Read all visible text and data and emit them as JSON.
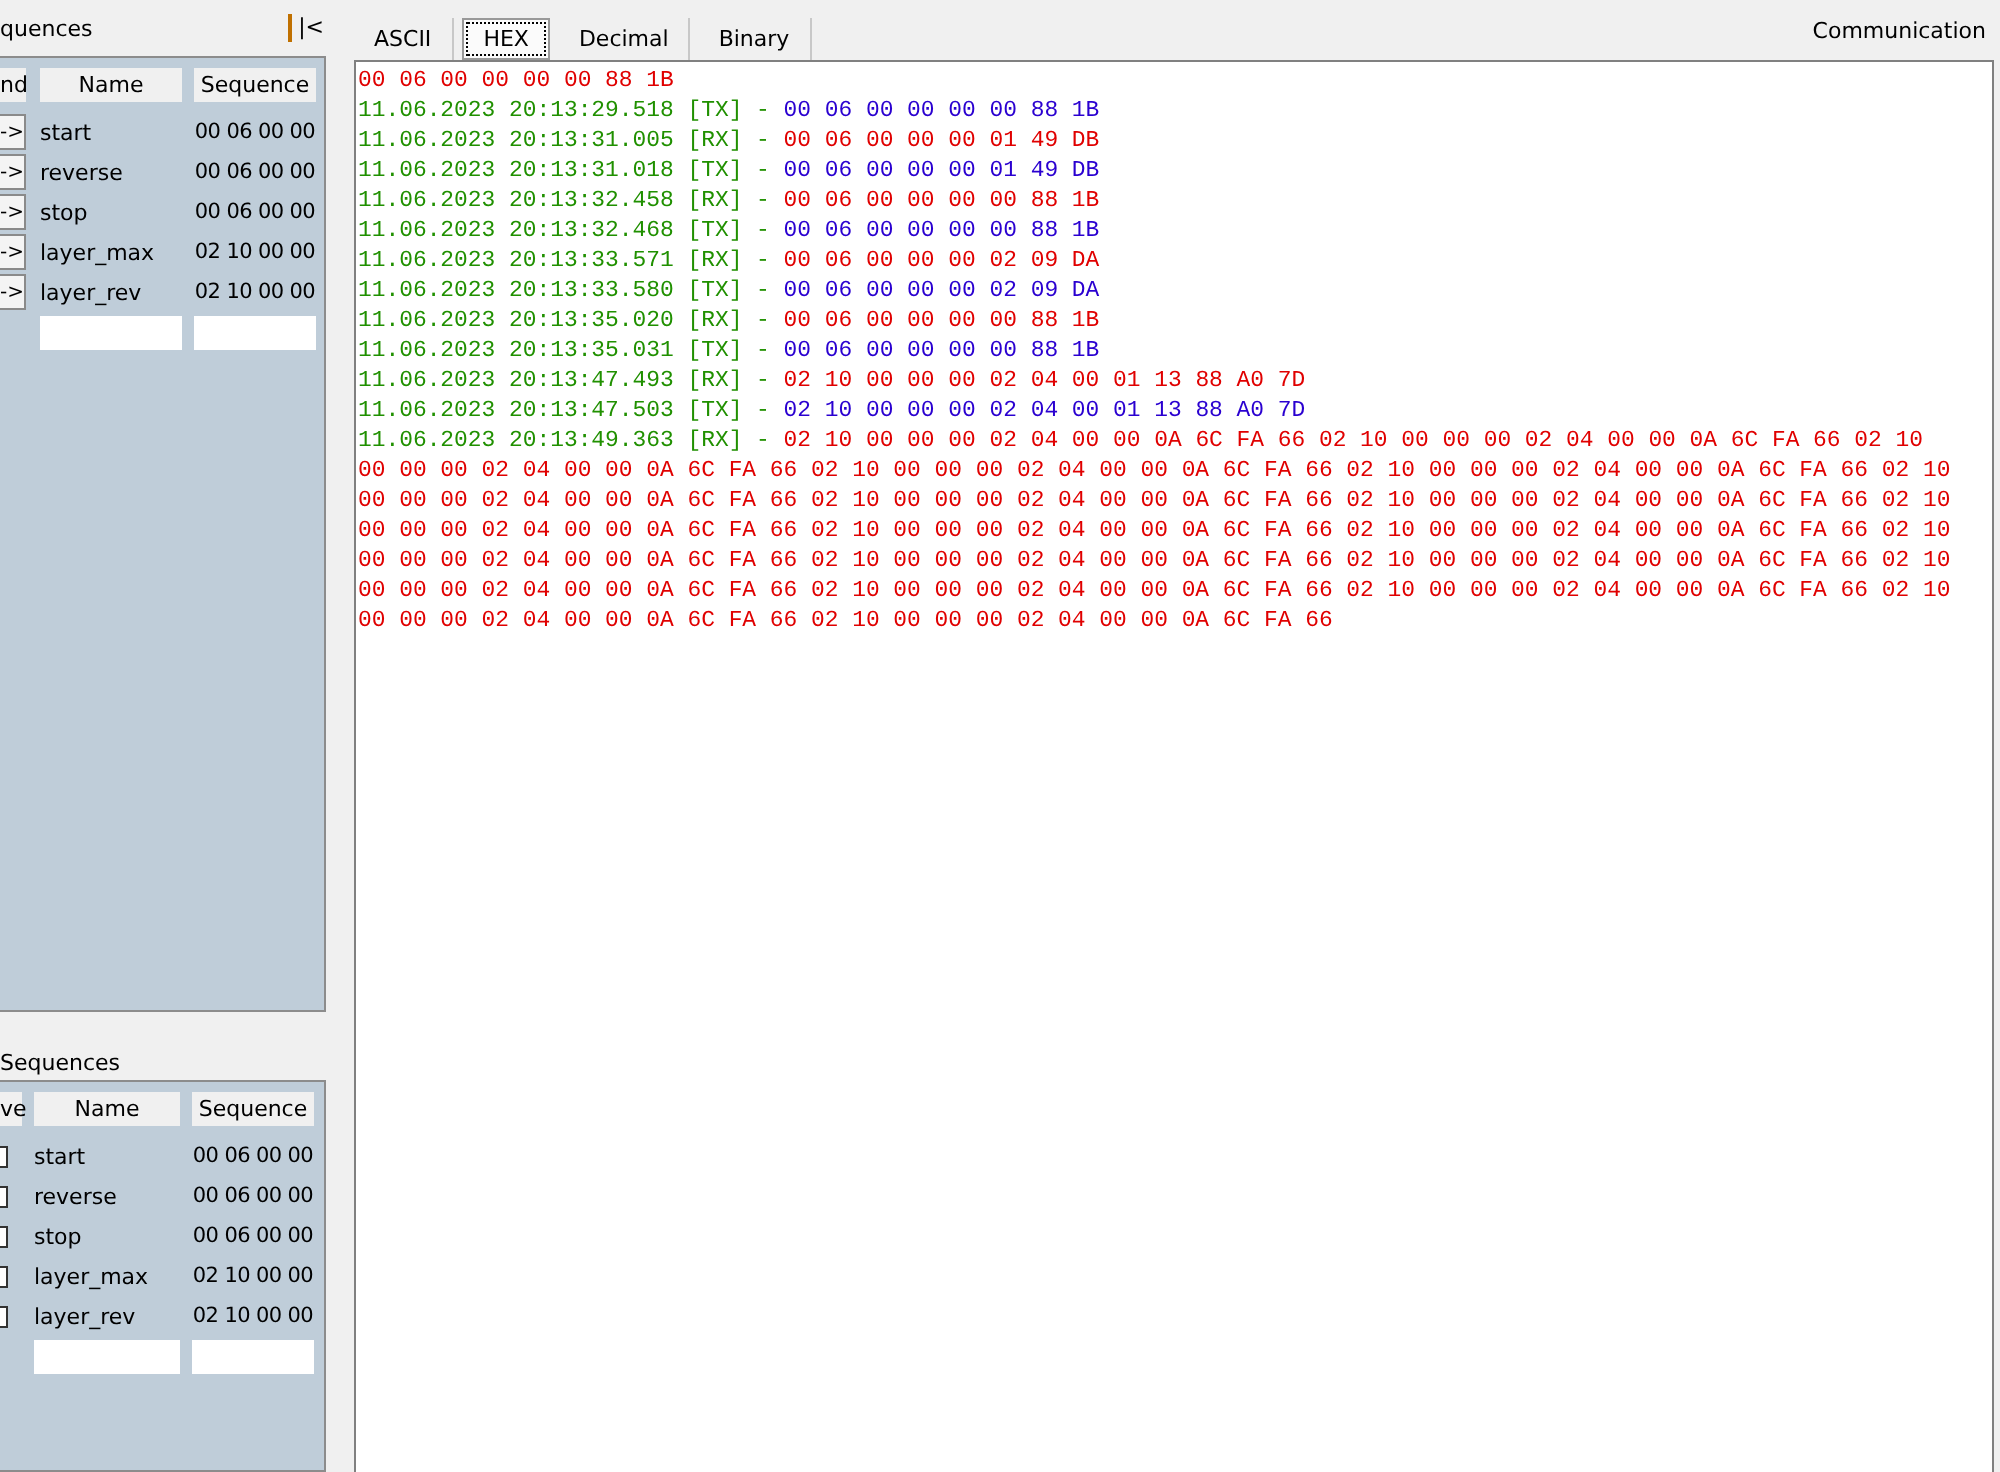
{
  "sidebar": {
    "collapse_button": "|<",
    "send_group": {
      "title": "quences",
      "columns": [
        "nd",
        "Name",
        "Sequence"
      ],
      "rows": [
        {
          "button": "->",
          "name": "start",
          "sequence": "00 06 00 00"
        },
        {
          "button": "->",
          "name": "reverse",
          "sequence": "00 06 00 00"
        },
        {
          "button": "->",
          "name": "stop",
          "sequence": "00 06 00 00"
        },
        {
          "button": "->",
          "name": "layer_max",
          "sequence": "02 10 00 00"
        },
        {
          "button": "->",
          "name": "layer_rev",
          "sequence": "02 10 00 00"
        }
      ]
    },
    "receive_group": {
      "title": "Sequences",
      "columns": [
        "ve",
        "Name",
        "Sequence"
      ],
      "rows": [
        {
          "checked": false,
          "name": "start",
          "sequence": "00 06 00 00"
        },
        {
          "checked": false,
          "name": "reverse",
          "sequence": "00 06 00 00"
        },
        {
          "checked": false,
          "name": "stop",
          "sequence": "00 06 00 00"
        },
        {
          "checked": false,
          "name": "layer_max",
          "sequence": "02 10 00 00"
        },
        {
          "checked": false,
          "name": "layer_rev",
          "sequence": "02 10 00 00"
        }
      ]
    }
  },
  "tabs": [
    {
      "label": "ASCII",
      "selected": false
    },
    {
      "label": "HEX",
      "selected": true
    },
    {
      "label": "Decimal",
      "selected": false
    },
    {
      "label": "Binary",
      "selected": false
    }
  ],
  "panel_title": "Communication",
  "log": [
    {
      "kind": "data",
      "received": true,
      "bytes": "00 06 00 00 00 00 88 1B"
    },
    {
      "kind": "entry",
      "timestamp": "11.06.2023 20:13:29.518",
      "tag": "[TX]",
      "separator": "-",
      "received": false,
      "bytes": "00 06 00 00 00 00 88 1B"
    },
    {
      "kind": "entry",
      "timestamp": "11.06.2023 20:13:31.005",
      "tag": "[RX]",
      "separator": "-",
      "received": true,
      "bytes": "00 06 00 00 00 01 49 DB"
    },
    {
      "kind": "entry",
      "timestamp": "11.06.2023 20:13:31.018",
      "tag": "[TX]",
      "separator": "-",
      "received": false,
      "bytes": "00 06 00 00 00 01 49 DB"
    },
    {
      "kind": "entry",
      "timestamp": "11.06.2023 20:13:32.458",
      "tag": "[RX]",
      "separator": "-",
      "received": true,
      "bytes": "00 06 00 00 00 00 88 1B"
    },
    {
      "kind": "entry",
      "timestamp": "11.06.2023 20:13:32.468",
      "tag": "[TX]",
      "separator": "-",
      "received": false,
      "bytes": "00 06 00 00 00 00 88 1B"
    },
    {
      "kind": "entry",
      "timestamp": "11.06.2023 20:13:33.571",
      "tag": "[RX]",
      "separator": "-",
      "received": true,
      "bytes": "00 06 00 00 00 02 09 DA"
    },
    {
      "kind": "entry",
      "timestamp": "11.06.2023 20:13:33.580",
      "tag": "[TX]",
      "separator": "-",
      "received": false,
      "bytes": "00 06 00 00 00 02 09 DA"
    },
    {
      "kind": "entry",
      "timestamp": "11.06.2023 20:13:35.020",
      "tag": "[RX]",
      "separator": "-",
      "received": true,
      "bytes": "00 06 00 00 00 00 88 1B"
    },
    {
      "kind": "entry",
      "timestamp": "11.06.2023 20:13:35.031",
      "tag": "[TX]",
      "separator": "-",
      "received": false,
      "bytes": "00 06 00 00 00 00 88 1B"
    },
    {
      "kind": "entry",
      "timestamp": "11.06.2023 20:13:47.493",
      "tag": "[RX]",
      "separator": "-",
      "received": true,
      "bytes": "02 10 00 00 00 02 04 00 01 13 88 A0 7D"
    },
    {
      "kind": "entry",
      "timestamp": "11.06.2023 20:13:47.503",
      "tag": "[TX]",
      "separator": "-",
      "received": false,
      "bytes": "02 10 00 00 00 02 04 00 01 13 88 A0 7D"
    },
    {
      "kind": "entry",
      "timestamp": "11.06.2023 20:13:49.363",
      "tag": "[RX]",
      "separator": "-",
      "received": true,
      "bytes": "02 10 00 00 00 02 04 00 00 0A 6C FA 66 02 10 00 00 00 02 04 00 00 0A 6C FA 66 02 10"
    },
    {
      "kind": "data",
      "received": true,
      "bytes": "00 00 00 02 04 00 00 0A 6C FA 66 02 10 00 00 00 02 04 00 00 0A 6C FA 66 02 10 00 00 00 02 04 00 00 0A 6C FA 66 02 10"
    },
    {
      "kind": "data",
      "received": true,
      "bytes": "00 00 00 02 04 00 00 0A 6C FA 66 02 10 00 00 00 02 04 00 00 0A 6C FA 66 02 10 00 00 00 02 04 00 00 0A 6C FA 66 02 10"
    },
    {
      "kind": "data",
      "received": true,
      "bytes": "00 00 00 02 04 00 00 0A 6C FA 66 02 10 00 00 00 02 04 00 00 0A 6C FA 66 02 10 00 00 00 02 04 00 00 0A 6C FA 66 02 10"
    },
    {
      "kind": "data",
      "received": true,
      "bytes": "00 00 00 02 04 00 00 0A 6C FA 66 02 10 00 00 00 02 04 00 00 0A 6C FA 66 02 10 00 00 00 02 04 00 00 0A 6C FA 66 02 10"
    },
    {
      "kind": "data",
      "received": true,
      "bytes": "00 00 00 02 04 00 00 0A 6C FA 66 02 10 00 00 00 02 04 00 00 0A 6C FA 66 02 10 00 00 00 02 04 00 00 0A 6C FA 66 02 10"
    },
    {
      "kind": "data",
      "received": true,
      "bytes": "00 00 00 02 04 00 00 0A 6C FA 66 02 10 00 00 00 02 04 00 00 0A 6C FA 66"
    }
  ]
}
